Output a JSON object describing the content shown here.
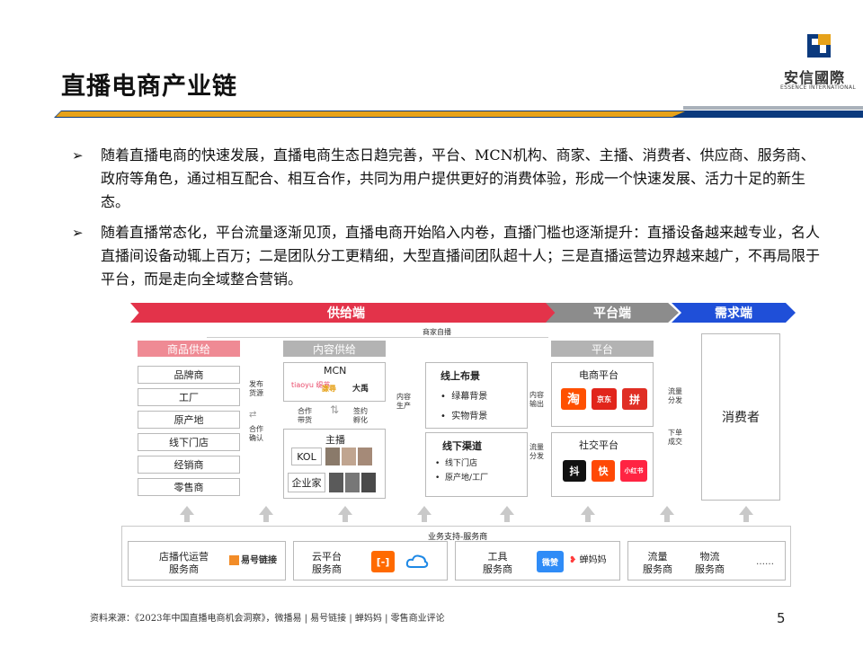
{
  "header": {
    "title": "直播电商产业链",
    "logo_cn": "安信國際",
    "logo_en": "ESSENCE INTERNATIONAL"
  },
  "bullets": [
    "随着直播电商的快速发展，直播电商生态日趋完善，平台、MCN机构、商家、主播、消费者、供应商、服务商、政府等角色，通过相互配合、相互合作，共同为用户提供更好的消费体验，形成一个快速发展、活力十足的新生态。",
    "随着直播常态化，平台流量逐渐见顶，直播电商开始陷入内卷，直播门槛也逐渐提升：直播设备越来越专业，名人直播间设备动辄上百万；二是团队分工更精细，大型直播间团队超十人；三是直播运营边界越来越广，不再局限于平台，而是走向全域整合营销。"
  ],
  "bullet_marker": "➢",
  "diagram": {
    "top_headers": {
      "supply": "供给端",
      "platform": "平台端",
      "demand": "需求端"
    },
    "merchant_live": "商家自播",
    "goods": {
      "title": "商品供给",
      "items": [
        "品牌商",
        "工厂",
        "原产地",
        "线下门店",
        "经销商",
        "零售商"
      ]
    },
    "content": {
      "title": "内容供给",
      "mcn": "MCN",
      "mcn_logos": [
        "tiaoyu 缇苏",
        "謙尋",
        "大禹"
      ],
      "anchor_title": "主播",
      "kol": "KOL",
      "entrepreneur": "企业家"
    },
    "online": {
      "title": "线上布景",
      "items": [
        "绿幕背景",
        "实物背景"
      ]
    },
    "offline": {
      "title": "线下渠道",
      "items": [
        "线下门店",
        "原产地/工厂"
      ]
    },
    "platform": {
      "title": "平台",
      "ecom": "电商平台",
      "ecom_logos": [
        "淘",
        "京东",
        "拼"
      ],
      "social": "社交平台",
      "social_logos": [
        "抖",
        "快",
        "小红书"
      ]
    },
    "consumer": "消费者",
    "links": {
      "publish": "发布\n货源",
      "cooperate_confirm": "合作\n确认",
      "cooperate_sell": "合作\n带货",
      "sign_incubate": "签约\n孵化",
      "content_produce": "内容\n生产",
      "content_output": "内容\n输出",
      "traffic_dist1": "流量\n分发",
      "traffic_dist2": "流量\n分发",
      "traffic_dist3": "流量\n分发",
      "order": "下单\n成交"
    },
    "services": {
      "title": "业务支持-服务商",
      "agency": "店播代运营\n服务商",
      "agency_logo": "易号链接",
      "cloud": "云平台\n服务商",
      "tool": "工具\n服务商",
      "tool_logos": [
        "微赞",
        "蝉妈妈"
      ],
      "traffic": "流量\n服务商",
      "logistics": "物流\n服务商",
      "ellipsis": "……"
    }
  },
  "footer": {
    "source": "资料来源：《2023年中国直播电商机会洞察》，微播易 | 易号链接 | 蝉妈妈 | 零售商业评论",
    "page": "5"
  },
  "colors": {
    "red": "#e3334a",
    "gray": "#8c8c8c",
    "blue": "#1f4fd8",
    "gold": "#e6a21a",
    "navy": "#0b3a7e"
  }
}
